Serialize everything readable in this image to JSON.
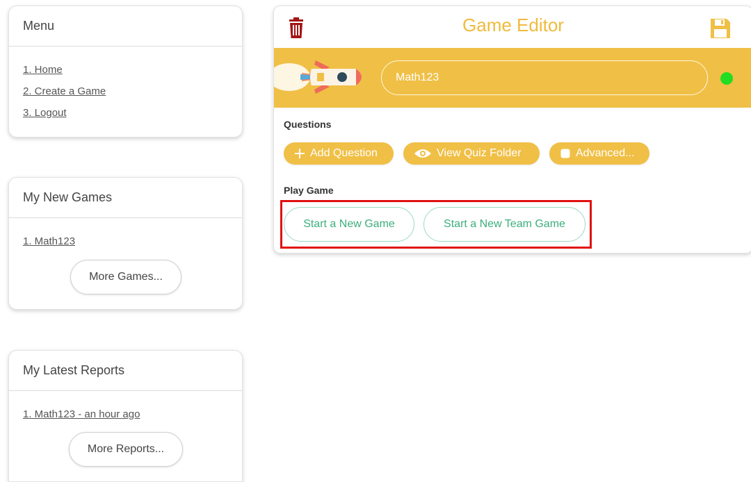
{
  "menu": {
    "title": "Menu",
    "items": [
      {
        "label": "1. Home"
      },
      {
        "label": "2. Create a Game"
      },
      {
        "label": "3. Logout"
      }
    ]
  },
  "new_games": {
    "title": "My New Games",
    "items": [
      {
        "label": "1. Math123"
      }
    ],
    "more_label": "More Games..."
  },
  "latest_reports": {
    "title": "My Latest Reports",
    "items": [
      {
        "label": "1. Math123 - an hour ago"
      }
    ],
    "more_label": "More Reports..."
  },
  "editor": {
    "title": "Game Editor",
    "game_name": "Math123",
    "status": "online",
    "questions_label": "Questions",
    "add_question_label": "Add Question",
    "view_quiz_folder_label": "View Quiz Folder",
    "advanced_label": "Advanced...",
    "play_game_label": "Play Game",
    "start_new_game_label": "Start a New Game",
    "start_new_team_game_label": "Start a New Team Game"
  },
  "colors": {
    "accent": "#f0bf45",
    "title": "#f0bb3c",
    "delete": "#a31515",
    "status_online": "#22dd22",
    "play_text": "#3cae7c",
    "highlight": "#e01010"
  },
  "icons": {
    "delete": "trash-icon",
    "save": "save-icon",
    "add": "plus-icon",
    "view": "eye-icon",
    "advanced": "checkbox-icon",
    "banner": "rocket-icon"
  }
}
